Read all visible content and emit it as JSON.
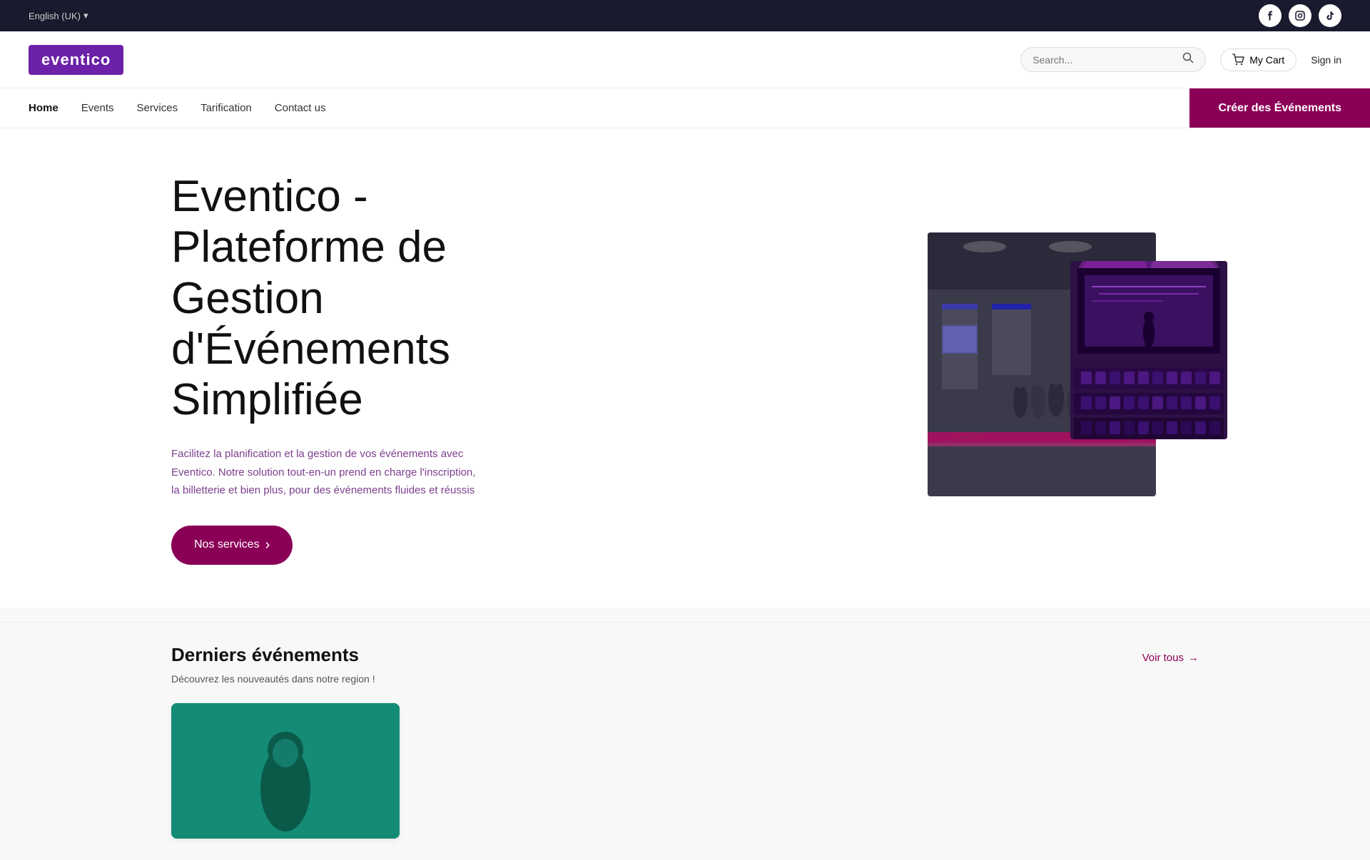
{
  "topbar": {
    "language": "English (UK)",
    "language_arrow": "▾",
    "social": [
      {
        "id": "facebook",
        "label": "f"
      },
      {
        "id": "instagram",
        "label": "IG"
      },
      {
        "id": "tiktok",
        "label": "TT"
      }
    ]
  },
  "header": {
    "logo": "eventico",
    "search_placeholder": "Search...",
    "cart_label": "My Cart",
    "signin_label": "Sign in"
  },
  "nav": {
    "links": [
      {
        "id": "home",
        "label": "Home",
        "active": true
      },
      {
        "id": "events",
        "label": "Events",
        "active": false
      },
      {
        "id": "services",
        "label": "Services",
        "active": false
      },
      {
        "id": "tarification",
        "label": "Tarification",
        "active": false
      },
      {
        "id": "contact",
        "label": "Contact us",
        "active": false
      }
    ],
    "cta_label": "Créer des Événements"
  },
  "hero": {
    "title": "Eventico - Plateforme de Gestion d'Événements Simplifiée",
    "subtitle": "Facilitez la planification et la gestion de vos événements avec Eventico. Notre solution tout-en-un prend en charge l'inscription, la billetterie et bien plus, pour des événements fluides et réussis",
    "btn_label": "Nos services",
    "btn_arrow": "›"
  },
  "recent_events": {
    "title": "Derniers événements",
    "subtitle": "Découvrez les nouveautés dans notre region !",
    "see_all_label": "Voir tous",
    "see_all_arrow": "→"
  }
}
